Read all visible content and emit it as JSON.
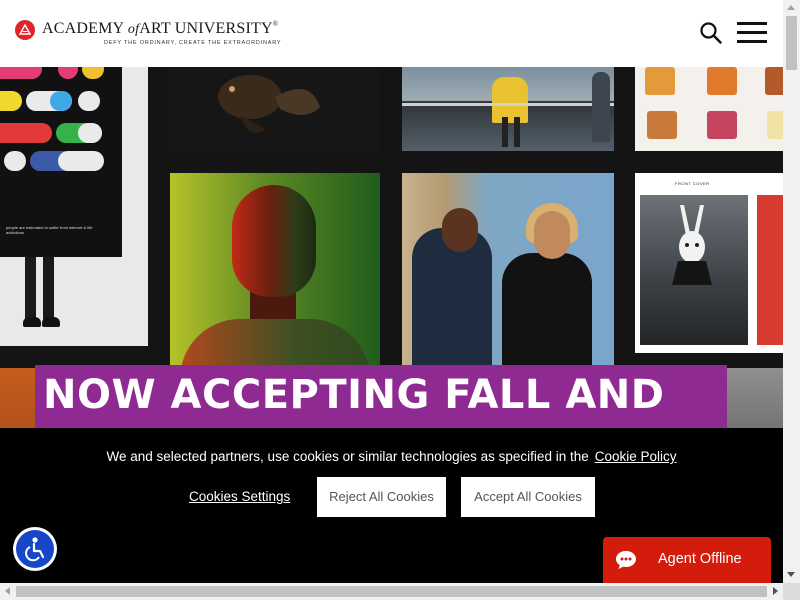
{
  "header": {
    "logo_name": "ACADEMY",
    "logo_of": "of",
    "logo_name_end": "ART UNIVERSITY",
    "logo_reg": "®",
    "tagline": "DEFY THE ORDINARY, CREATE THE EXTRAORDINARY",
    "search_icon": "search-icon",
    "menu_icon": "hamburger-menu-icon"
  },
  "hero": {
    "poster_caption": "people are estimated to suffer from internet & life addictions",
    "cover_label": "FRONT COVER",
    "promo_heading": "NOW ACCEPTING FALL AND SPRING APPLICATIONS"
  },
  "cookie_banner": {
    "message": "We and selected partners, use cookies or similar technologies as specified in the",
    "policy_link": "Cookie Policy",
    "settings_link": "Cookies Settings",
    "reject_label": "Reject All Cookies",
    "accept_label": "Accept All Cookies"
  },
  "accessibility": {
    "icon": "accessibility-icon"
  },
  "chat": {
    "label": "Agent Offline",
    "icon": "chat-bubble-icon"
  },
  "colors": {
    "brand_red": "#e0242b",
    "promo_purple": "#8f2a92",
    "chat_red": "#d41c0d",
    "a11y_blue": "#1747c8"
  }
}
